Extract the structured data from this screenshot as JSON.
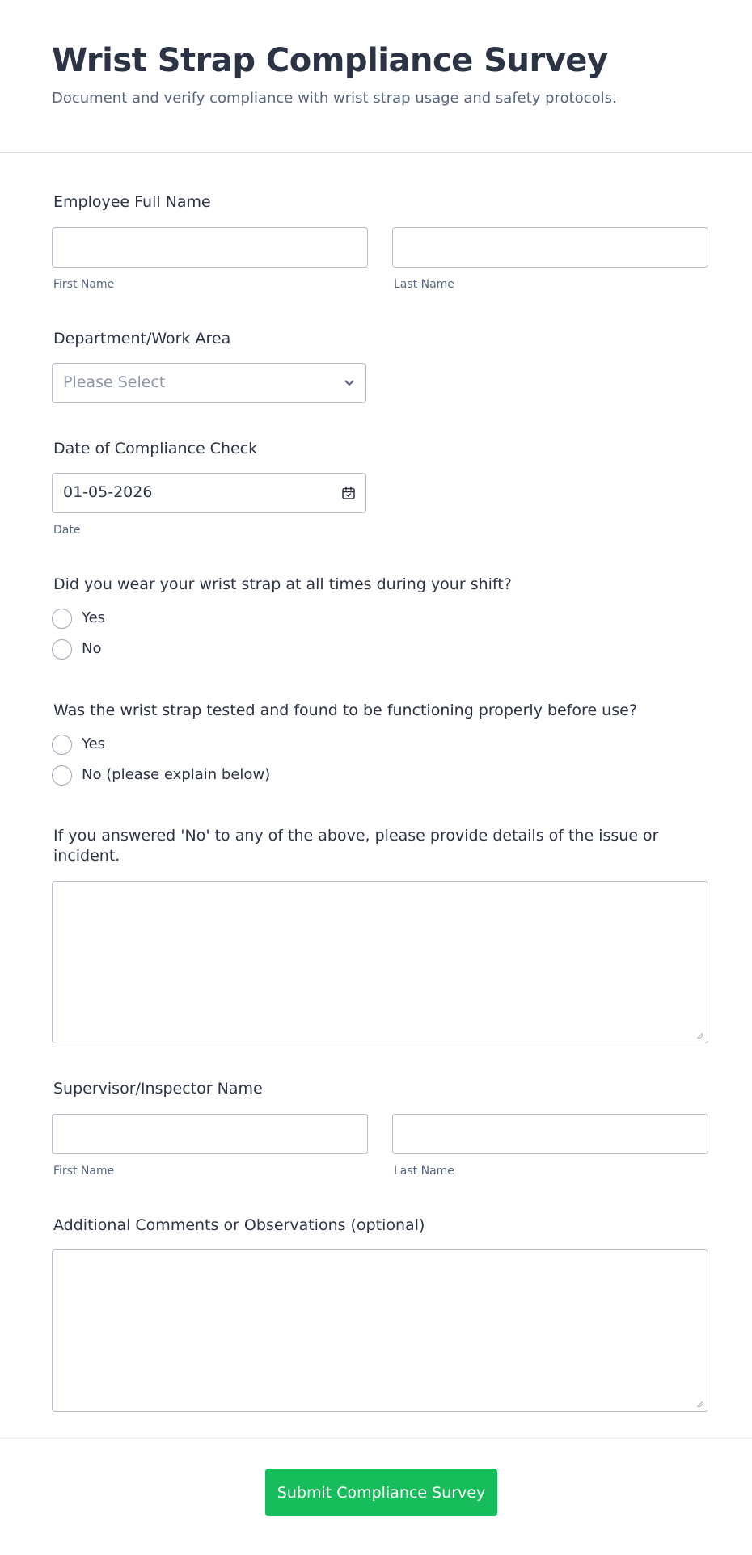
{
  "header": {
    "title": "Wrist Strap Compliance Survey",
    "subtitle": "Document and verify compliance with wrist strap usage and safety protocols."
  },
  "employee_name": {
    "label": "Employee Full Name",
    "first_value": "",
    "last_value": "",
    "first_sublabel": "First Name",
    "last_sublabel": "Last Name"
  },
  "department": {
    "label": "Department/Work Area",
    "placeholder": "Please Select",
    "icon": "chevron-down-icon"
  },
  "check_date": {
    "label": "Date of Compliance Check",
    "value": "01-05-2026",
    "sublabel": "Date",
    "icon": "calendar-icon"
  },
  "q_wear": {
    "label": "Did you wear your wrist strap at all times during your shift?",
    "options": [
      "Yes",
      "No"
    ]
  },
  "q_tested": {
    "label": "Was the wrist strap tested and found to be functioning properly before use?",
    "options": [
      "Yes",
      "No (please explain below)"
    ]
  },
  "details": {
    "label_line1": "If you answered 'No' to any of the above, please provide details of the issue or",
    "label_line2": "incident.",
    "value": ""
  },
  "supervisor_name": {
    "label": "Supervisor/Inspector Name",
    "first_value": "",
    "last_value": "",
    "first_sublabel": "First Name",
    "last_sublabel": "Last Name"
  },
  "comments": {
    "label": "Additional Comments or Observations (optional)",
    "value": ""
  },
  "submit": {
    "label": "Submit Compliance Survey",
    "color": "#18bd5b"
  }
}
